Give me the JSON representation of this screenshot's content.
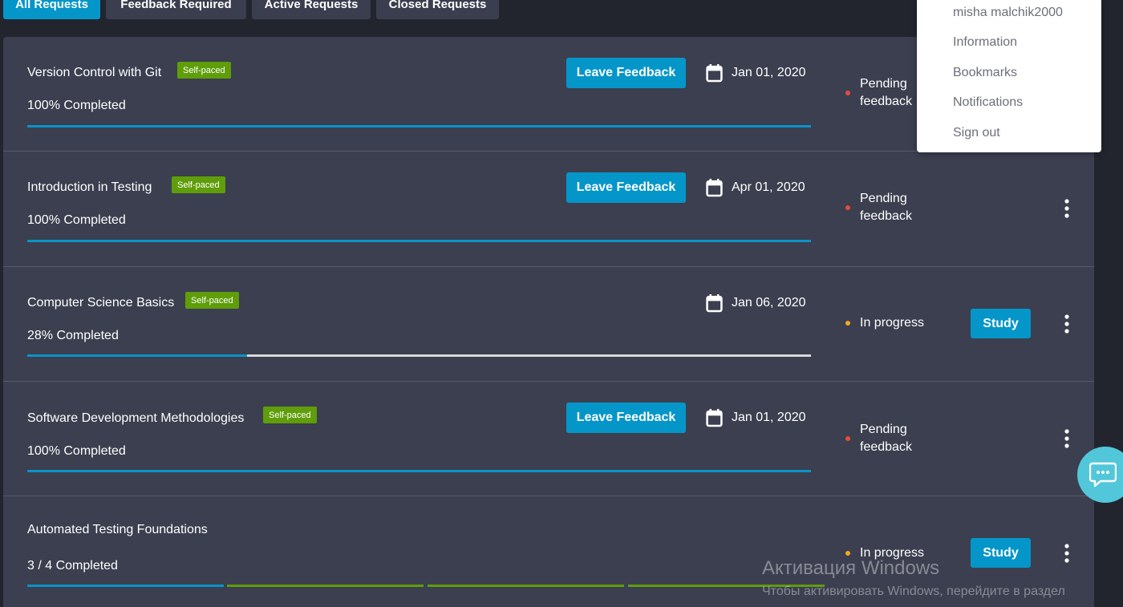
{
  "tabs": [
    {
      "label": "All Requests",
      "active": true
    },
    {
      "label": "Feedback Required",
      "active": false
    },
    {
      "label": "Active Requests",
      "active": false
    },
    {
      "label": "Closed Requests",
      "active": false
    }
  ],
  "courses": [
    {
      "title": "Version Control with Git",
      "badge": "Self-paced",
      "progress_text": "100% Completed",
      "progress": 1.0,
      "action": "Leave Feedback",
      "date": "Jan 01, 2020",
      "status": "Pending feedback",
      "status_color": "#e74c3c"
    },
    {
      "title": "Introduction in Testing",
      "badge": "Self-paced",
      "progress_text": "100% Completed",
      "progress": 1.0,
      "action": "Leave Feedback",
      "date": "Apr 01, 2020",
      "status": "Pending feedback",
      "status_color": "#e74c3c"
    },
    {
      "title": "Computer Science Basics",
      "badge": "Self-paced",
      "progress_text": "28% Completed",
      "progress": 0.28,
      "date": "Jan 06, 2020",
      "status": "In progress",
      "status_color": "#f5a623",
      "study_label": "Study"
    },
    {
      "title": "Software Development Methodologies",
      "badge": "Self-paced",
      "progress_text": "100% Completed",
      "progress": 1.0,
      "action": "Leave Feedback",
      "date": "Jan 01, 2020",
      "status": "Pending feedback",
      "status_color": "#e74c3c"
    },
    {
      "title": "Automated Testing Foundations",
      "progress_text": "3 / 4 Completed",
      "progress": 0.75,
      "status": "In progress",
      "status_color": "#f5a623",
      "study_label": "Study"
    }
  ],
  "user_menu": {
    "username": "misha malchik2000",
    "items": [
      "Information",
      "Bookmarks",
      "Notifications",
      "Sign out"
    ]
  },
  "icons": {
    "calendar": "calendar-icon",
    "more": "more-vertical-icon",
    "chat": "chat-icon"
  },
  "colors": {
    "accent": "#0596c9",
    "badge": "#5f9d0a",
    "pending": "#e74c3c",
    "in_progress": "#f5a623",
    "segment_done_first": "#0a93c9",
    "segment_done": "#5f9d0a"
  },
  "watermark": {
    "title": "Активация Windows",
    "subtitle": "Чтобы активировать Windows, перейдите в раздел"
  }
}
